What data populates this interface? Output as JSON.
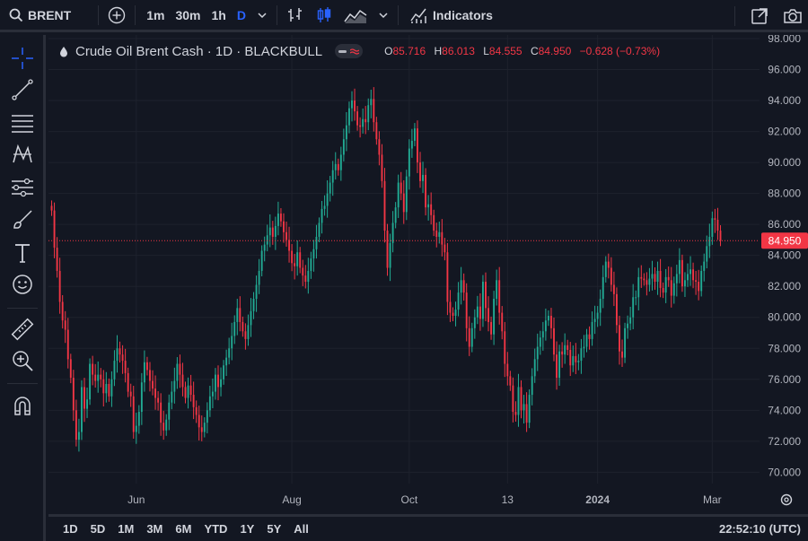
{
  "toolbar": {
    "symbol": "BRENT",
    "intervals": [
      "1m",
      "30m",
      "1h",
      "D"
    ],
    "active_interval": "D",
    "indicators_label": "Indicators",
    "icons": [
      "search-icon",
      "add-symbol-icon",
      "chevron-down-icon",
      "bar-style-icon",
      "candles-icon",
      "area-style-icon",
      "indicators-icon",
      "fullscreen-icon",
      "camera-icon"
    ]
  },
  "left_tools": [
    "crosshair-icon",
    "trend-line-icon",
    "fib-retracement-icon",
    "pattern-icon",
    "forecast-icon",
    "brush-icon",
    "text-icon",
    "emoji-icon",
    "ruler-icon",
    "zoom-in-icon",
    "magnet-icon"
  ],
  "legend": {
    "title": "Crude Oil Brent Cash · 1D · BLACKBULL",
    "o_label": "O",
    "o_value": "85.716",
    "h_label": "H",
    "h_value": "86.013",
    "l_label": "L",
    "l_value": "84.555",
    "c_label": "C",
    "c_value": "84.950",
    "change": "−0.628 (−0.73%)"
  },
  "bottom": {
    "ranges": [
      "1D",
      "5D",
      "1M",
      "3M",
      "6M",
      "YTD",
      "1Y",
      "5Y",
      "All"
    ],
    "clock": "22:52:10 (UTC)"
  },
  "chart_data": {
    "type": "candlestick",
    "x_labels": [
      "Jun",
      "Aug",
      "Oct",
      "13",
      "2024",
      "Mar"
    ],
    "y_ticks": [
      "70.000",
      "72.000",
      "74.000",
      "76.000",
      "78.000",
      "80.000",
      "82.000",
      "84.000",
      "86.000",
      "88.000",
      "90.000",
      "92.000",
      "94.000",
      "96.000",
      "98.000"
    ],
    "ylim": [
      69.5,
      98
    ],
    "last_price": 84.95,
    "last_price_label": "84.950",
    "colors": {
      "up": "#22ab94",
      "down": "#f23645",
      "background": "#131722",
      "grid": "#1e222d"
    },
    "closes": [
      86.9,
      84.5,
      83.0,
      81.0,
      79.8,
      79.2,
      77.3,
      76.1,
      74.0,
      72.1,
      72.6,
      75.5,
      74.1,
      74.7,
      77.0,
      76.3,
      75.9,
      76.3,
      76.0,
      75.1,
      75.7,
      74.9,
      76.0,
      77.2,
      78.0,
      77.6,
      77.2,
      76.4,
      75.2,
      74.9,
      72.6,
      73.0,
      73.9,
      75.8,
      77.1,
      76.6,
      75.9,
      75.4,
      74.8,
      74.5,
      73.2,
      72.7,
      73.4,
      74.5,
      75.2,
      75.9,
      77.0,
      76.3,
      75.5,
      74.8,
      75.6,
      75.0,
      74.2,
      73.7,
      72.9,
      72.6,
      73.2,
      74.0,
      74.9,
      75.2,
      76.3,
      75.5,
      76.0,
      76.9,
      77.4,
      78.0,
      78.8,
      79.7,
      80.6,
      79.7,
      79.1,
      78.6,
      79.5,
      80.4,
      81.2,
      82.1,
      83.0,
      84.3,
      84.7,
      85.3,
      85.8,
      85.2,
      85.9,
      86.7,
      86.2,
      85.5,
      85.0,
      84.3,
      83.5,
      83.3,
      84.2,
      83.2,
      82.7,
      82.3,
      83.0,
      83.8,
      84.4,
      85.2,
      86.1,
      87.0,
      87.2,
      88.0,
      88.7,
      89.5,
      89.9,
      89.5,
      90.5,
      91.5,
      92.4,
      93.5,
      94.0,
      93.3,
      92.4,
      92.3,
      92.8,
      92.6,
      93.7,
      94.1,
      92.6,
      91.5,
      90.5,
      88.8,
      85.6,
      83.2,
      84.8,
      86.1,
      87.1,
      88.7,
      88.0,
      86.8,
      89.1,
      90.9,
      91.4,
      92.2,
      90.0,
      88.8,
      89.2,
      87.1,
      87.3,
      86.6,
      85.6,
      85.2,
      85.5,
      84.7,
      84.2,
      81.0,
      80.3,
      80.1,
      80.5,
      81.6,
      82.4,
      81.6,
      79.3,
      78.1,
      79.3,
      80.0,
      80.7,
      79.9,
      82.3,
      80.6,
      79.7,
      78.9,
      81.2,
      82.4,
      80.3,
      79.1,
      77.0,
      76.2,
      75.6,
      73.9,
      73.7,
      75.5,
      74.0,
      74.4,
      73.2,
      75.0,
      76.2,
      77.3,
      78.1,
      78.7,
      79.1,
      79.8,
      80.1,
      79.3,
      77.6,
      76.1,
      77.8,
      77.6,
      78.2,
      77.9,
      76.9,
      77.5,
      77.1,
      77.2,
      78.0,
      78.1,
      78.9,
      78.6,
      79.7,
      79.9,
      80.3,
      81.2,
      82.6,
      83.6,
      83.2,
      82.1,
      81.5,
      79.5,
      77.8,
      77.4,
      79.3,
      79.6,
      80.0,
      81.3,
      81.3,
      82.6,
      82.5,
      82.4,
      82.1,
      82.5,
      82.8,
      82.3,
      83.0,
      81.9,
      81.6,
      82.6,
      82.4,
      81.4,
      82.2,
      82.8,
      83.7,
      82.0,
      82.4,
      82.8,
      83.1,
      82.4,
      82.3,
      81.7,
      83.0,
      83.6,
      84.6,
      85.2,
      86.4,
      86.3,
      85.6,
      84.95
    ]
  }
}
